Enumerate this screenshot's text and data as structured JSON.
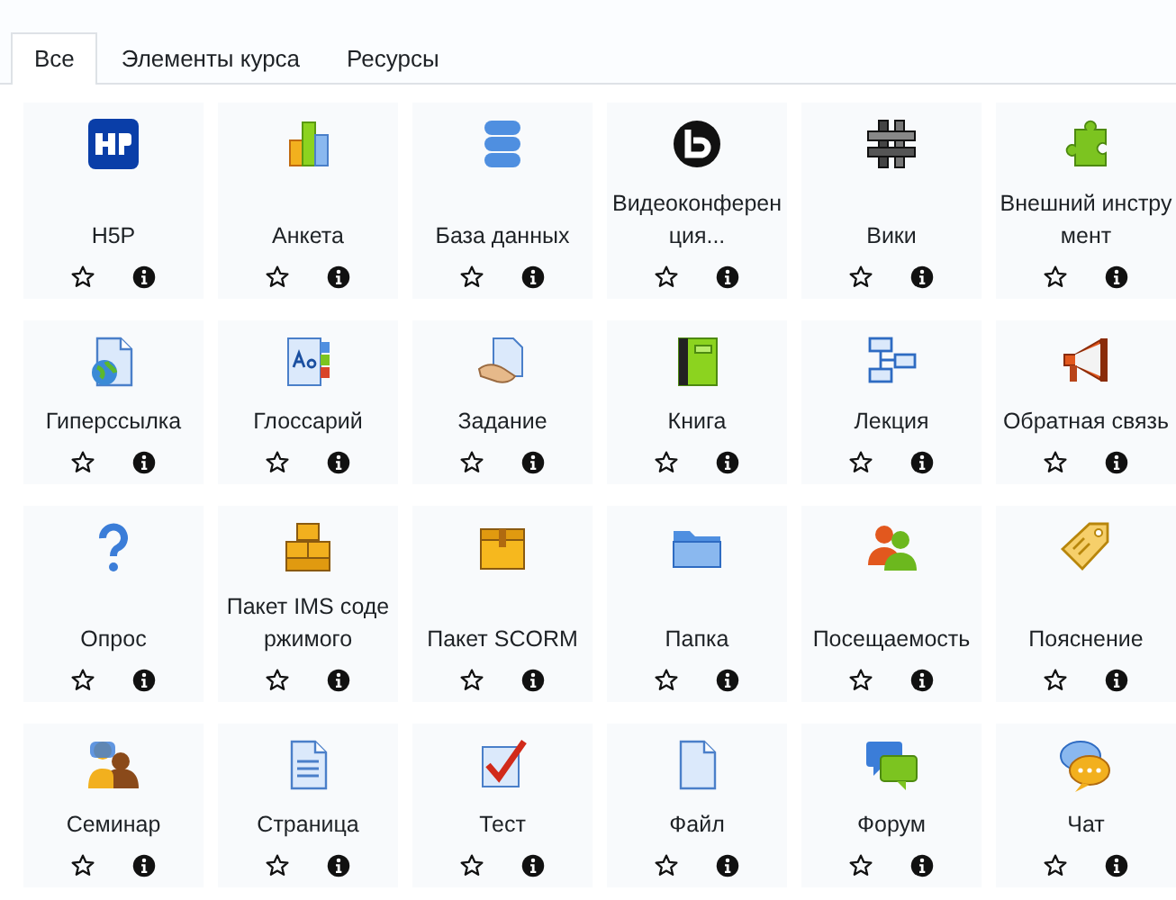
{
  "tabs": [
    {
      "label": "Все",
      "selected": true
    },
    {
      "label": "Элементы курса",
      "selected": false
    },
    {
      "label": "Ресурсы",
      "selected": false
    }
  ],
  "modules": [
    {
      "name": "H5P",
      "starred": false
    },
    {
      "name": "Анкета",
      "starred": false
    },
    {
      "name": "База данных",
      "starred": false
    },
    {
      "name": "Видеоконференция...",
      "starred": false
    },
    {
      "name": "Вики",
      "starred": false
    },
    {
      "name": "Внешний инструмент",
      "starred": false
    },
    {
      "name": "Гиперссылка",
      "starred": false
    },
    {
      "name": "Глоссарий",
      "starred": false
    },
    {
      "name": "Задание",
      "starred": false
    },
    {
      "name": "Книга",
      "starred": false
    },
    {
      "name": "Лекция",
      "starred": false
    },
    {
      "name": "Обратная связь",
      "starred": false
    },
    {
      "name": "Опрос",
      "starred": false
    },
    {
      "name": "Пакет IMS содержимого",
      "starred": false
    },
    {
      "name": "Пакет SCORM",
      "starred": false
    },
    {
      "name": "Папка",
      "starred": false
    },
    {
      "name": "Посещаемость",
      "starred": false
    },
    {
      "name": "Пояснение",
      "starred": false
    },
    {
      "name": "Семинар",
      "starred": false
    },
    {
      "name": "Страница",
      "starred": false
    },
    {
      "name": "Тест",
      "starred": false
    },
    {
      "name": "Файл",
      "starred": false
    },
    {
      "name": "Форум",
      "starred": false
    },
    {
      "name": "Чат",
      "starred": false
    }
  ]
}
